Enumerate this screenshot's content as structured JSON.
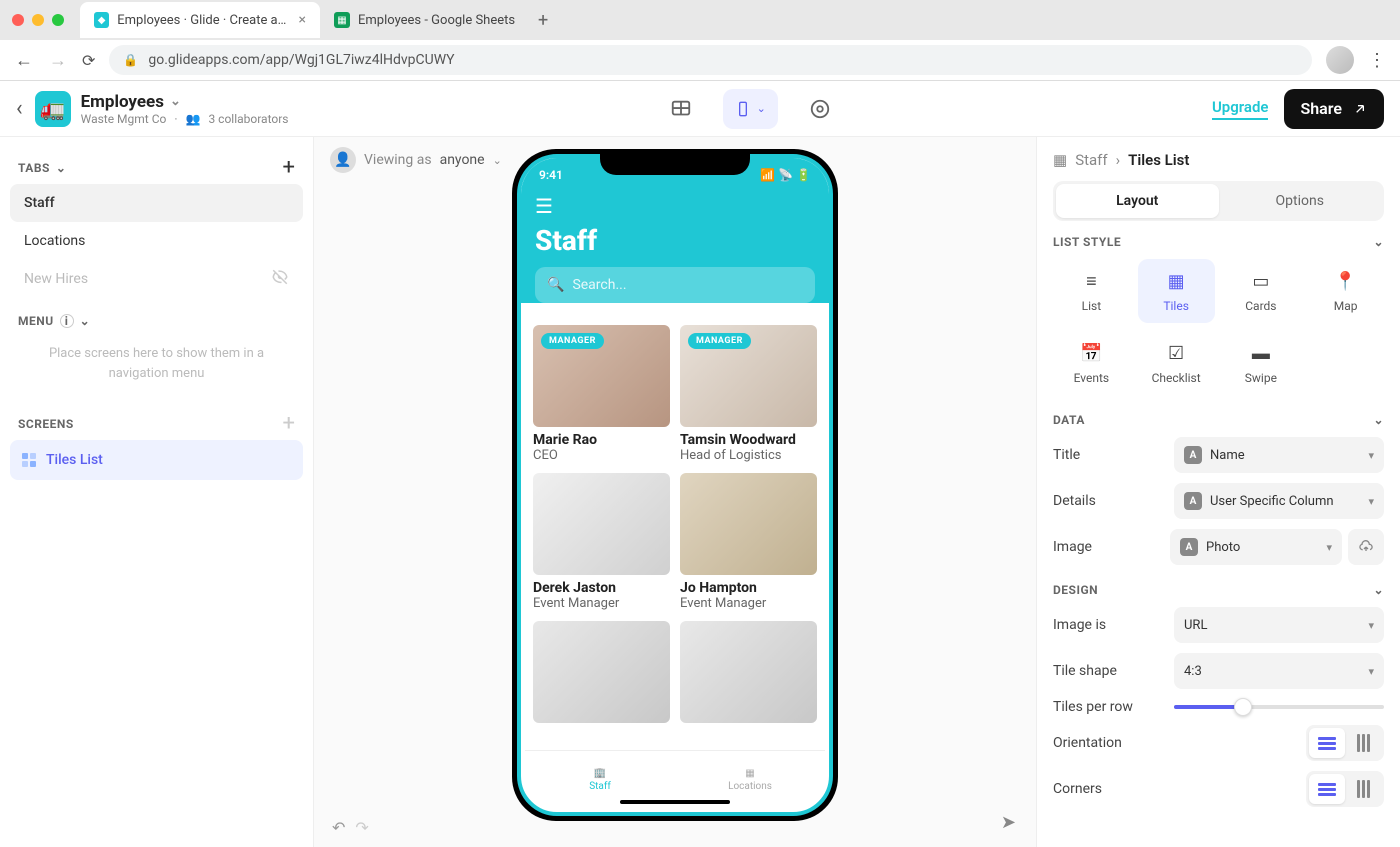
{
  "browser": {
    "tabs": [
      {
        "label": "Employees · Glide · Create apps",
        "active": true,
        "favicon": "#1fc7d4"
      },
      {
        "label": "Employees - Google Sheets",
        "active": false,
        "favicon": "#0f9d58"
      }
    ],
    "url": "go.glideapps.com/app/Wgj1GL7iwz4lHdvpCUWY"
  },
  "app_header": {
    "name": "Employees",
    "org": "Waste Mgmt Co",
    "collaborators": "3 collaborators",
    "upgrade": "Upgrade",
    "share": "Share"
  },
  "left_panel": {
    "tabs_label": "TABS",
    "tabs": [
      {
        "label": "Staff",
        "active": true
      },
      {
        "label": "Locations",
        "active": false
      },
      {
        "label": "New Hires",
        "active": false,
        "hidden": true
      }
    ],
    "menu_label": "MENU",
    "menu_placeholder": "Place screens here to show them in a navigation menu",
    "screens_label": "SCREENS",
    "screens": [
      {
        "label": "Tiles List",
        "active": true
      }
    ]
  },
  "viewing_as": {
    "prefix": "Viewing as",
    "value": "anyone"
  },
  "phone": {
    "time": "9:41",
    "title": "Staff",
    "search_placeholder": "Search...",
    "tiles": [
      {
        "name": "Marie Rao",
        "role": "CEO",
        "badge": "MANAGER"
      },
      {
        "name": "Tamsin Woodward",
        "role": "Head of Logistics",
        "badge": "MANAGER"
      },
      {
        "name": "Derek Jaston",
        "role": "Event Manager"
      },
      {
        "name": "Jo Hampton",
        "role": "Event Manager"
      }
    ],
    "tabbar": [
      {
        "label": "Staff",
        "active": true
      },
      {
        "label": "Locations",
        "active": false
      }
    ]
  },
  "right_panel": {
    "breadcrumb_parent": "Staff",
    "breadcrumb_current": "Tiles List",
    "segments": {
      "layout": "Layout",
      "options": "Options"
    },
    "list_style_label": "LIST STYLE",
    "list_styles": [
      "List",
      "Tiles",
      "Cards",
      "Map",
      "Events",
      "Checklist",
      "Swipe"
    ],
    "data_label": "DATA",
    "data_props": {
      "title": {
        "label": "Title",
        "value": "Name"
      },
      "details": {
        "label": "Details",
        "value": "User Specific Column"
      },
      "image": {
        "label": "Image",
        "value": "Photo"
      }
    },
    "design_label": "DESIGN",
    "design_props": {
      "image_is": {
        "label": "Image is",
        "value": "URL"
      },
      "tile_shape": {
        "label": "Tile shape",
        "value": "4:3"
      },
      "tiles_per_row": {
        "label": "Tiles per row"
      },
      "orientation": {
        "label": "Orientation"
      },
      "corners": {
        "label": "Corners"
      }
    }
  }
}
